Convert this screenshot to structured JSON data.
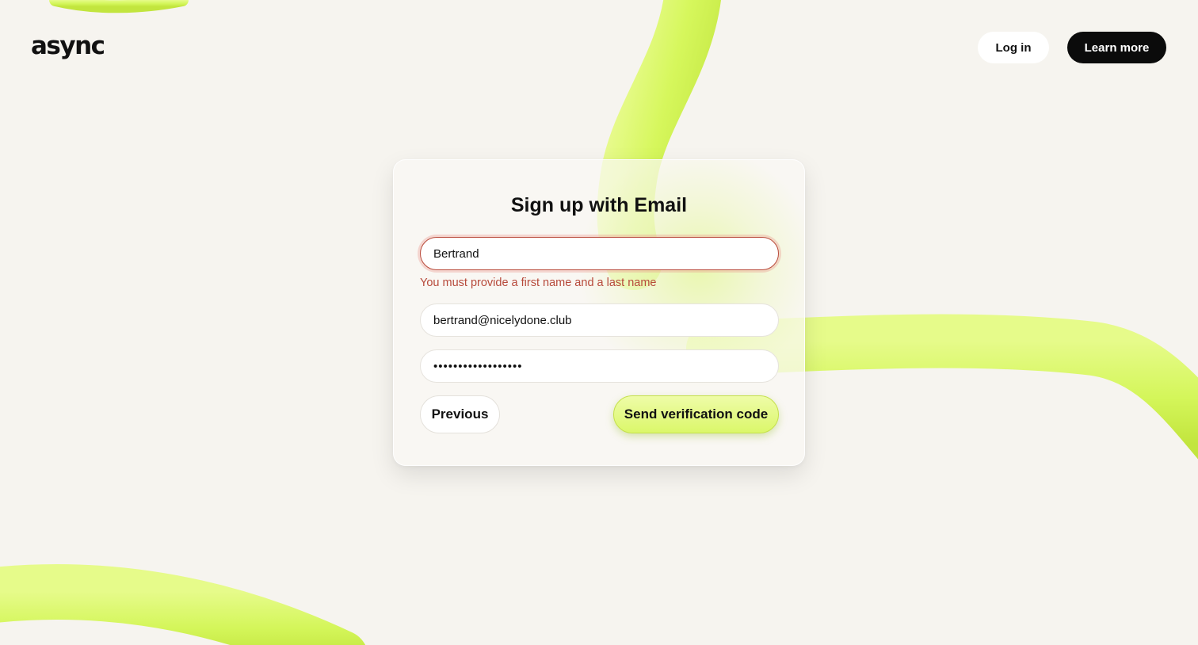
{
  "brand": {
    "logo_text": "async"
  },
  "header": {
    "login_label": "Log in",
    "learn_more_label": "Learn more"
  },
  "signup": {
    "title": "Sign up with Email",
    "name_value": "Bertrand",
    "name_error": "You must provide a first name and a last name",
    "email_value": "bertrand@nicelydone.club",
    "password_value": "••••••••••••••••••",
    "previous_label": "Previous",
    "send_code_label": "Send verification code"
  },
  "colors": {
    "background": "#f6f4ef",
    "ribbon": "#d6f75c",
    "error": "#b74a3b",
    "primary_dark": "#0b0b0b"
  }
}
